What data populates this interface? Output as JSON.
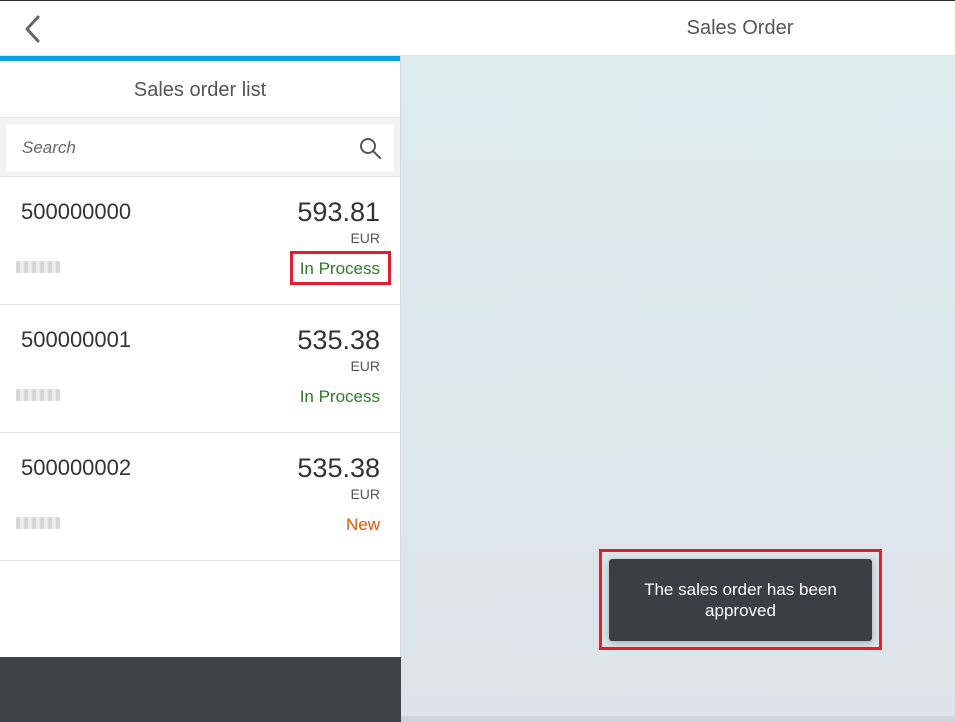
{
  "header": {
    "title": "Sales Order",
    "back_icon": "chevron-left-icon"
  },
  "master": {
    "title": "Sales order list",
    "search": {
      "placeholder": "Search",
      "value": "",
      "icon": "search-icon"
    },
    "items": [
      {
        "id": "500000000",
        "amount": "593.81",
        "currency": "EUR",
        "status": "In Process",
        "status_state": "success"
      },
      {
        "id": "500000001",
        "amount": "535.38",
        "currency": "EUR",
        "status": "In Process",
        "status_state": "success"
      },
      {
        "id": "500000002",
        "amount": "535.38",
        "currency": "EUR",
        "status": "New",
        "status_state": "warning"
      }
    ]
  },
  "toast": {
    "message": "The sales order has been approved"
  },
  "colors": {
    "accent": "#0a9fde",
    "status_success": "#2b7c2b",
    "status_warning": "#e25400",
    "highlight": "#e0202e",
    "toast_bg": "#3b3e44",
    "footer_bg": "#3f4247"
  }
}
